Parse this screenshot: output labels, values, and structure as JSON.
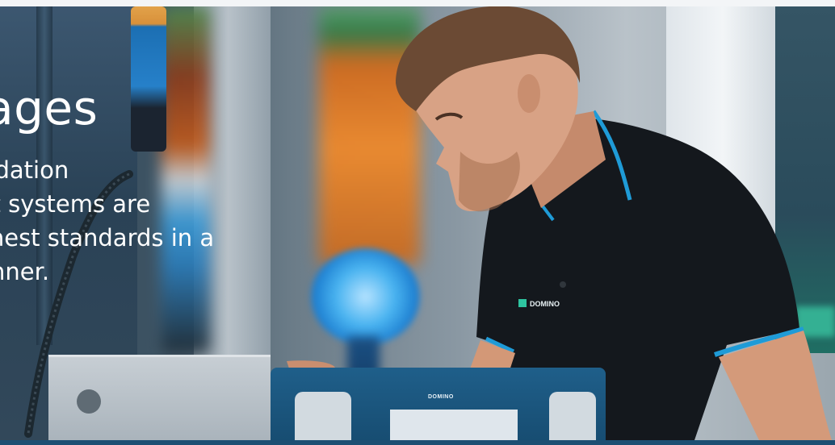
{
  "hero": {
    "title": "kages",
    "description_lines": [
      "Validation",
      " that systems are",
      "highest standards in a",
      "manner."
    ]
  },
  "device": {
    "logo_text": "DOMINO"
  },
  "shirt": {
    "logo_text": "DOMINO"
  },
  "colors": {
    "accent_blue": "#1d4f73",
    "shirt_trim": "#1f9bd7",
    "logo_green": "#2ec4a0"
  }
}
